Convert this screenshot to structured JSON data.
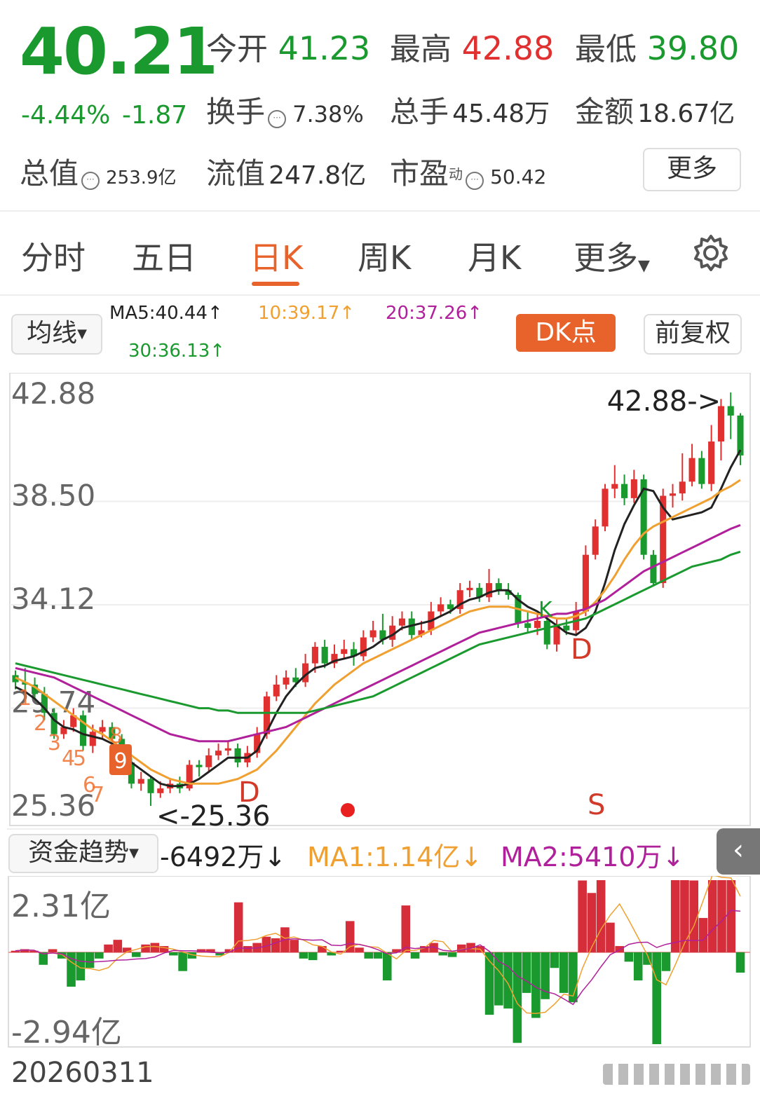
{
  "quote": {
    "price": "40.21",
    "change_pct": "-4.44%",
    "change": "-1.87",
    "open_label": "今开",
    "open": "41.23",
    "high_label": "最高",
    "high": "42.88",
    "low_label": "最低",
    "low": "39.80",
    "turnover_label": "换手",
    "turnover": "7.38%",
    "volume_label": "总手",
    "volume": "45.48万",
    "amount_label": "金额",
    "amount": "18.67亿",
    "mktcap_label": "总值",
    "mktcap": "253.9亿",
    "float_label": "流值",
    "float_cap": "247.8亿",
    "pe_label": "市盈",
    "pe_sup": "动",
    "pe": "50.42",
    "more_label": "更多",
    "info_icon": "ellipsis-circle-icon"
  },
  "tabs": {
    "items": [
      {
        "label": "分时"
      },
      {
        "label": "五日"
      },
      {
        "label": "日K"
      },
      {
        "label": "周K"
      },
      {
        "label": "月K"
      },
      {
        "label": "更多"
      }
    ],
    "active_index": 2,
    "settings_icon": "gear-icon",
    "accent_color": "#e8632b"
  },
  "ma_bar": {
    "selector": "均线",
    "ma5": "MA5:40.44↑",
    "ma10": "10:39.17↑",
    "ma20": "20:37.26↑",
    "ma30": "30:36.13↑",
    "dk_label": "DK点",
    "adjust_label": "前复权",
    "colors": {
      "ma5": "#222222",
      "ma10": "#f0a030",
      "ma20": "#b0209a",
      "ma30": "#1a9a2e"
    }
  },
  "chart_data": [
    {
      "type": "candlestick",
      "ylim": [
        25.36,
        42.88
      ],
      "y_ticks": [
        "42.88",
        "38.50",
        "34.12",
        "29.74",
        "25.36"
      ],
      "y_tick_values": [
        42.88,
        38.5,
        34.12,
        29.74,
        25.36
      ],
      "annotations": {
        "high_marker": "42.88->",
        "low_marker": "<-25.36",
        "signals": [
          "D",
          "D",
          "S",
          "K"
        ],
        "td_counts": [
          "1",
          "2",
          "3",
          "4",
          "5",
          "6",
          "7",
          "8",
          "9"
        ]
      },
      "up_color": "#e03030",
      "down_color": "#1a9a2e",
      "candles": [
        [
          30.9,
          30.6,
          31.1,
          30.3
        ],
        [
          30.6,
          30.5,
          31.2,
          30.2
        ],
        [
          30.5,
          30.1,
          30.8,
          29.9
        ],
        [
          30.1,
          29.3,
          30.4,
          29.0
        ],
        [
          29.3,
          28.4,
          29.5,
          28.2
        ],
        [
          28.4,
          28.7,
          29.0,
          28.2
        ],
        [
          28.7,
          29.2,
          29.5,
          28.5
        ],
        [
          29.2,
          27.9,
          29.4,
          27.7
        ],
        [
          27.9,
          28.5,
          28.8,
          27.6
        ],
        [
          28.5,
          28.7,
          29.0,
          28.2
        ],
        [
          28.7,
          28.2,
          28.9,
          27.9
        ],
        [
          28.2,
          27.2,
          28.4,
          27.0
        ],
        [
          27.2,
          26.3,
          27.4,
          26.1
        ],
        [
          26.3,
          26.5,
          26.8,
          26.0
        ],
        [
          26.5,
          25.9,
          26.6,
          25.36
        ],
        [
          25.9,
          26.1,
          26.4,
          25.7
        ],
        [
          26.1,
          26.3,
          26.5,
          25.9
        ],
        [
          26.3,
          26.1,
          26.6,
          25.9
        ],
        [
          26.1,
          27.1,
          27.3,
          26.0
        ],
        [
          27.1,
          27.0,
          27.3,
          26.6
        ],
        [
          27.0,
          27.5,
          27.8,
          26.8
        ],
        [
          27.5,
          27.7,
          28.0,
          27.3
        ],
        [
          27.7,
          27.8,
          28.1,
          27.5
        ],
        [
          27.8,
          27.2,
          28.0,
          27.0
        ],
        [
          27.2,
          27.6,
          27.9,
          27.0
        ],
        [
          27.6,
          28.4,
          28.7,
          27.4
        ],
        [
          28.4,
          30.0,
          30.2,
          28.2
        ],
        [
          30.0,
          30.5,
          30.9,
          29.8
        ],
        [
          30.5,
          30.8,
          31.1,
          30.3
        ],
        [
          30.8,
          30.6,
          31.2,
          30.4
        ],
        [
          30.6,
          31.4,
          31.8,
          30.4
        ],
        [
          31.4,
          32.1,
          32.3,
          31.0
        ],
        [
          32.1,
          31.4,
          32.4,
          31.2
        ],
        [
          31.4,
          31.8,
          32.2,
          31.2
        ],
        [
          31.8,
          32.0,
          32.4,
          31.6
        ],
        [
          32.0,
          31.7,
          32.3,
          31.3
        ],
        [
          31.7,
          32.5,
          32.8,
          31.5
        ],
        [
          32.5,
          32.8,
          33.2,
          32.3
        ],
        [
          32.8,
          32.4,
          33.5,
          32.2
        ],
        [
          32.4,
          33.0,
          33.4,
          32.1
        ],
        [
          33.0,
          33.3,
          33.6,
          32.8
        ],
        [
          33.3,
          32.6,
          33.6,
          32.4
        ],
        [
          32.6,
          32.8,
          33.2,
          32.5
        ],
        [
          32.8,
          33.6,
          34.0,
          32.6
        ],
        [
          33.6,
          33.9,
          34.2,
          33.4
        ],
        [
          33.9,
          33.7,
          34.1,
          33.5
        ],
        [
          33.7,
          34.5,
          34.8,
          33.5
        ],
        [
          34.5,
          34.6,
          34.9,
          34.2
        ],
        [
          34.6,
          34.2,
          34.8,
          34.0
        ],
        [
          34.2,
          34.8,
          35.4,
          34.0
        ],
        [
          34.8,
          34.5,
          35.0,
          34.3
        ],
        [
          34.5,
          34.3,
          34.8,
          34.1
        ],
        [
          34.3,
          33.1,
          34.4,
          32.9
        ],
        [
          33.1,
          32.9,
          33.6,
          32.7
        ],
        [
          32.9,
          33.2,
          33.5,
          32.6
        ],
        [
          33.2,
          32.2,
          33.4,
          32.0
        ],
        [
          32.2,
          33.0,
          33.3,
          31.9
        ],
        [
          33.0,
          32.8,
          33.3,
          32.6
        ],
        [
          32.8,
          33.6,
          34.0,
          32.6
        ],
        [
          33.6,
          36.0,
          36.4,
          33.4
        ],
        [
          36.0,
          37.2,
          37.5,
          35.8
        ],
        [
          37.2,
          38.8,
          39.0,
          37.0
        ],
        [
          38.8,
          39.0,
          39.8,
          38.4
        ],
        [
          39.0,
          38.4,
          39.4,
          38.1
        ],
        [
          38.4,
          39.2,
          39.6,
          38.2
        ],
        [
          39.2,
          36.0,
          39.4,
          35.8
        ],
        [
          36.0,
          34.8,
          36.2,
          34.7
        ],
        [
          34.8,
          38.5,
          38.8,
          34.6
        ],
        [
          38.5,
          38.6,
          39.0,
          38.0
        ],
        [
          38.6,
          39.1,
          40.3,
          38.3
        ],
        [
          39.1,
          40.1,
          40.7,
          38.9
        ],
        [
          40.1,
          39.0,
          40.4,
          38.8
        ],
        [
          39.0,
          40.8,
          41.5,
          38.7
        ],
        [
          40.8,
          42.3,
          42.6,
          40.0
        ],
        [
          42.3,
          41.9,
          42.88,
          40.9
        ],
        [
          41.9,
          40.21,
          42.0,
          39.8
        ]
      ],
      "ma_lines": [
        {
          "name": "MA5",
          "color": "#222222",
          "values": [
            30.4,
            30.2,
            29.9,
            29.5,
            29.0,
            28.7,
            28.6,
            28.4,
            28.3,
            28.2,
            28.0,
            27.6,
            27.2,
            26.9,
            26.6,
            26.3,
            26.2,
            26.2,
            26.3,
            26.5,
            26.8,
            27.1,
            27.4,
            27.4,
            27.4,
            27.7,
            28.5,
            29.3,
            30.0,
            30.5,
            30.9,
            31.2,
            31.3,
            31.5,
            31.6,
            31.7,
            31.9,
            32.1,
            32.4,
            32.6,
            32.9,
            33.0,
            33.1,
            33.2,
            33.4,
            33.6,
            33.9,
            34.1,
            34.2,
            34.4,
            34.5,
            34.5,
            34.1,
            33.8,
            33.6,
            33.3,
            33.0,
            32.7,
            32.6,
            32.9,
            33.6,
            34.8,
            36.2,
            37.3,
            38.1,
            38.8,
            38.7,
            38.0,
            37.5,
            37.6,
            37.7,
            37.8,
            38.0,
            38.8,
            39.7,
            40.44
          ]
        },
        {
          "name": "MA10",
          "color": "#f0a030",
          "values": [
            30.8,
            30.6,
            30.4,
            30.1,
            29.8,
            29.5,
            29.2,
            28.9,
            28.6,
            28.4,
            28.1,
            27.8,
            27.5,
            27.2,
            26.9,
            26.7,
            26.5,
            26.4,
            26.3,
            26.3,
            26.3,
            26.3,
            26.4,
            26.5,
            26.7,
            26.9,
            27.3,
            27.7,
            28.2,
            28.7,
            29.2,
            29.7,
            30.1,
            30.5,
            30.8,
            31.1,
            31.4,
            31.6,
            31.8,
            32.0,
            32.2,
            32.4,
            32.6,
            32.8,
            33.0,
            33.2,
            33.4,
            33.6,
            33.7,
            33.8,
            33.8,
            33.8,
            33.7,
            33.6,
            33.5,
            33.4,
            33.3,
            33.3,
            33.4,
            33.6,
            34.0,
            34.5,
            35.1,
            35.8,
            36.4,
            36.9,
            37.2,
            37.4,
            37.6,
            37.8,
            38.0,
            38.2,
            38.4,
            38.7,
            38.9,
            39.17
          ]
        },
        {
          "name": "MA20",
          "color": "#b0209a",
          "values": [
            31.2,
            31.1,
            31.0,
            30.9,
            30.8,
            30.6,
            30.4,
            30.2,
            30.0,
            29.8,
            29.6,
            29.4,
            29.2,
            29.0,
            28.8,
            28.6,
            28.4,
            28.3,
            28.2,
            28.1,
            28.1,
            28.1,
            28.1,
            28.2,
            28.3,
            28.4,
            28.5,
            28.6,
            28.7,
            28.9,
            29.1,
            29.3,
            29.5,
            29.7,
            29.9,
            30.1,
            30.3,
            30.5,
            30.7,
            30.9,
            31.1,
            31.3,
            31.5,
            31.7,
            31.9,
            32.1,
            32.3,
            32.5,
            32.7,
            32.8,
            32.9,
            33.0,
            33.1,
            33.2,
            33.3,
            33.4,
            33.5,
            33.5,
            33.6,
            33.7,
            33.9,
            34.1,
            34.4,
            34.7,
            35.0,
            35.3,
            35.5,
            35.7,
            35.9,
            36.1,
            36.3,
            36.5,
            36.7,
            36.9,
            37.1,
            37.26
          ]
        },
        {
          "name": "MA30",
          "color": "#1a9a2e",
          "values": [
            31.4,
            31.3,
            31.2,
            31.1,
            31.0,
            30.9,
            30.8,
            30.7,
            30.6,
            30.5,
            30.4,
            30.3,
            30.2,
            30.1,
            30.0,
            29.9,
            29.8,
            29.7,
            29.6,
            29.5,
            29.5,
            29.4,
            29.4,
            29.3,
            29.3,
            29.3,
            29.3,
            29.3,
            29.3,
            29.3,
            29.3,
            29.4,
            29.5,
            29.6,
            29.7,
            29.8,
            29.9,
            30.0,
            30.2,
            30.4,
            30.6,
            30.8,
            31.0,
            31.2,
            31.4,
            31.6,
            31.8,
            32.0,
            32.2,
            32.3,
            32.4,
            32.5,
            32.6,
            32.7,
            32.8,
            32.9,
            33.0,
            33.1,
            33.2,
            33.3,
            33.5,
            33.7,
            33.9,
            34.1,
            34.3,
            34.5,
            34.7,
            34.9,
            35.1,
            35.3,
            35.5,
            35.6,
            35.7,
            35.8,
            36.0,
            36.13
          ]
        }
      ]
    },
    {
      "type": "bar",
      "title_selector": "资金趋势",
      "current": "-6492万↓",
      "ma1": "MA1:1.14亿↓",
      "ma2": "MA2:5410万↓",
      "ylim": [
        -2.94,
        2.31
      ],
      "unit": "亿",
      "y_ticks": [
        "2.31亿",
        "-2.94亿"
      ],
      "x_label": "20260311",
      "values": [
        0.05,
        0.1,
        0.05,
        -0.4,
        0.1,
        -0.2,
        -1.1,
        -0.9,
        -0.5,
        -0.2,
        0.25,
        0.4,
        0.15,
        -0.15,
        0.25,
        0.3,
        0.2,
        -0.1,
        -0.6,
        -0.2,
        0.1,
        0.1,
        -0.1,
        0.1,
        1.6,
        0.2,
        0.3,
        0.5,
        0.45,
        0.8,
        0.4,
        -0.2,
        -0.25,
        0.2,
        -0.1,
        0.05,
        1.0,
        0.15,
        -0.2,
        -0.2,
        -0.9,
        0.1,
        1.5,
        -0.2,
        0.2,
        0.3,
        -0.1,
        -0.15,
        0.25,
        0.3,
        0.2,
        -2.0,
        -1.7,
        -1.8,
        -2.9,
        -1.3,
        -2.1,
        -1.5,
        -0.5,
        -1.3,
        -1.6,
        2.3,
        1.9,
        2.4,
        0.95,
        0.2,
        -0.3,
        -0.9,
        -0.4,
        -3.0,
        -0.6,
        2.9,
        2.6,
        2.3,
        1.1,
        3.5,
        2.5,
        2.5,
        -0.65
      ],
      "pos_color": "#d52d3a",
      "neg_color": "#1a9a2e",
      "collapse_icon": "chevron-left-icon"
    }
  ]
}
